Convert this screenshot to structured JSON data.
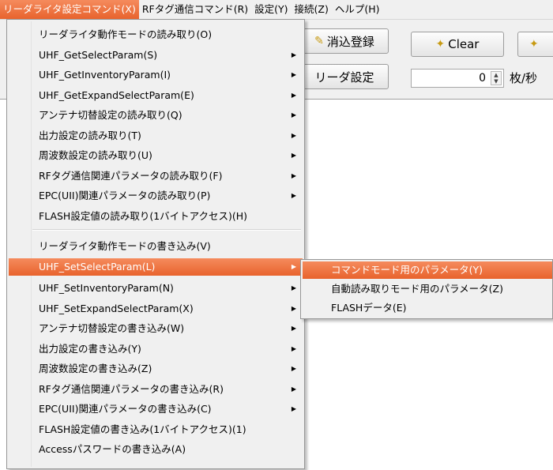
{
  "menubar": {
    "items": [
      {
        "label": "リーダライタ設定コマンド(X)",
        "active": true
      },
      {
        "label": "RFタグ通信コマンド(R)"
      },
      {
        "label": "設定(Y)"
      },
      {
        "label": "接続(Z)"
      },
      {
        "label": "ヘルプ(H)"
      }
    ]
  },
  "toolbar": {
    "erase_register_label": "消込登録",
    "clear_label": "Clear",
    "reader_settings_label": "リーダ設定",
    "rate_value": "0",
    "rate_unit": "枚/秒"
  },
  "dropdown": {
    "items": [
      {
        "label": "リーダライタ動作モードの読み取り(O)"
      },
      {
        "label": "UHF_GetSelectParam(S)"
      },
      {
        "label": "UHF_GetInventoryParam(I)"
      },
      {
        "label": "UHF_GetExpandSelectParam(E)"
      },
      {
        "label": "アンテナ切替設定の読み取り(Q)"
      },
      {
        "label": "出力設定の読み取り(T)"
      },
      {
        "label": "周波数設定の読み取り(U)"
      },
      {
        "label": "RFタグ通信関連パラメータの読み取り(F)"
      },
      {
        "label": "EPC(UII)関連パラメータの読み取り(P)"
      },
      {
        "label": "FLASH設定値の読み取り(1バイトアクセス)(H)"
      },
      {
        "label": "リーダライタ動作モードの書き込み(V)"
      },
      {
        "label": "UHF_SetSelectParam(L)"
      },
      {
        "label": "UHF_SetInventoryParam(N)"
      },
      {
        "label": "UHF_SetExpandSelectParam(X)"
      },
      {
        "label": "アンテナ切替設定の書き込み(W)"
      },
      {
        "label": "出力設定の書き込み(Y)"
      },
      {
        "label": "周波数設定の書き込み(Z)"
      },
      {
        "label": "RFタグ通信関連パラメータの書き込み(R)"
      },
      {
        "label": "EPC(UII)関連パラメータの書き込み(C)"
      },
      {
        "label": "FLASH設定値の書き込み(1バイトアクセス)(1)"
      },
      {
        "label": "Accessパスワードの書き込み(A)"
      }
    ]
  },
  "submenu": {
    "items": [
      {
        "label": "コマンドモード用のパラメータ(Y)"
      },
      {
        "label": "自動読み取りモード用のパラメータ(Z)"
      },
      {
        "label": "FLASHデータ(E)"
      }
    ]
  },
  "colors": {
    "highlight": "#e8632d",
    "menu_bg": "#f0f0f0"
  }
}
